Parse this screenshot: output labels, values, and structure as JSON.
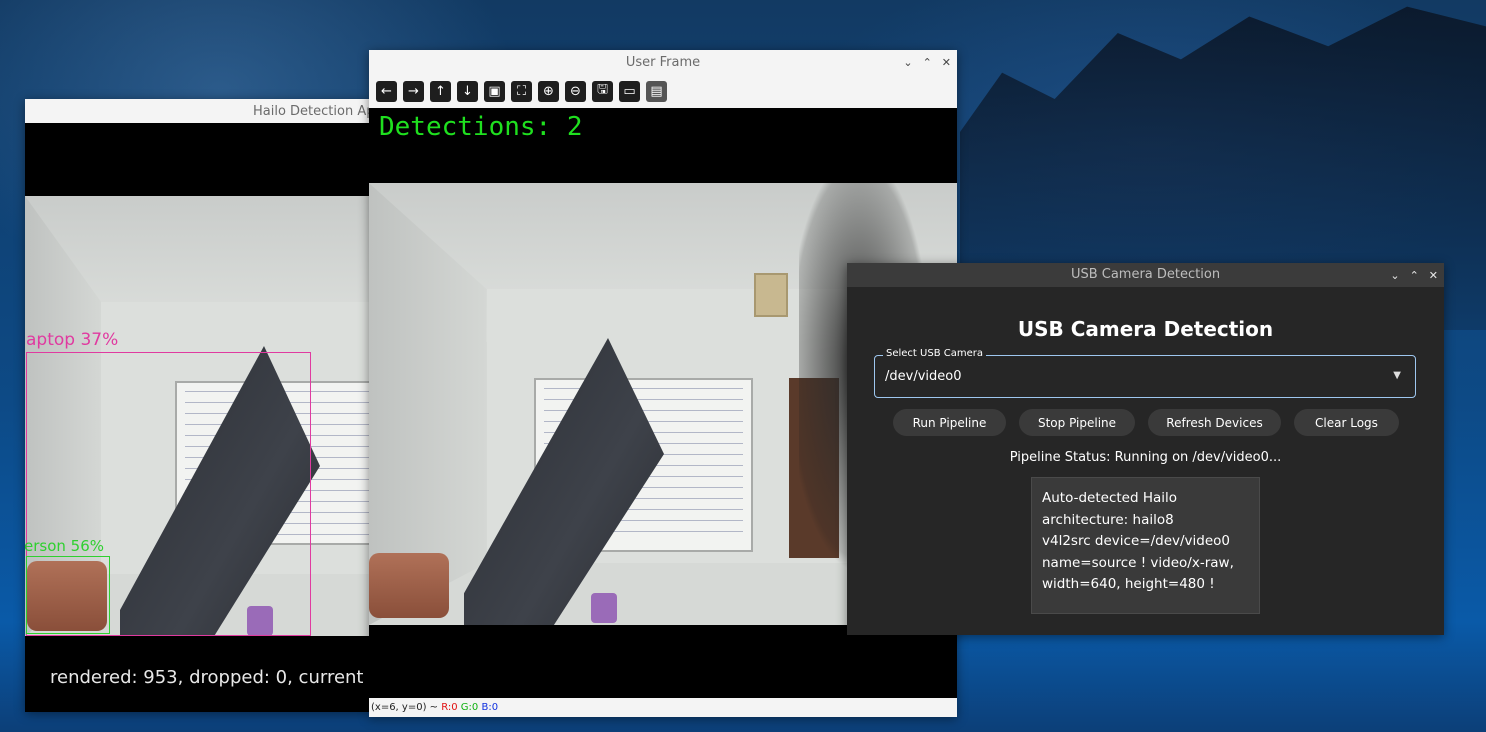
{
  "hailo_window": {
    "title": "Hailo Detection Ap",
    "detections": [
      {
        "label": "aptop 37%",
        "color": "#e03aa0"
      },
      {
        "label": "erson 56%",
        "color": "#2fd02f"
      }
    ],
    "stats_text": "rendered: 953, dropped: 0, current"
  },
  "user_frame": {
    "title": "User Frame",
    "controls": [
      "chevron-down-icon",
      "chevron-up-icon",
      "close-icon"
    ],
    "toolbar": [
      {
        "name": "pan-left",
        "icon": "←"
      },
      {
        "name": "pan-right",
        "icon": "→"
      },
      {
        "name": "pan-up",
        "icon": "↑"
      },
      {
        "name": "pan-down",
        "icon": "↓"
      },
      {
        "name": "zoom-image",
        "icon": "▣"
      },
      {
        "name": "zoom-fit",
        "icon": "⛶"
      },
      {
        "name": "zoom-in",
        "icon": "⊕"
      },
      {
        "name": "zoom-out",
        "icon": "⊖"
      },
      {
        "name": "save",
        "icon": "🖫"
      },
      {
        "name": "copy",
        "icon": "▭"
      },
      {
        "name": "properties",
        "icon": "▤"
      }
    ],
    "detections_text": "Detections: 2",
    "status": {
      "coords": "(x=6, y=0) ~",
      "r": "R:0",
      "g": "G:0",
      "b": "B:0"
    }
  },
  "usb_window": {
    "title": "USB Camera Detection",
    "heading": "USB Camera Detection",
    "select_label": "Select USB Camera",
    "select_value": "/dev/video0",
    "buttons": {
      "run": "Run Pipeline",
      "stop": "Stop Pipeline",
      "refresh": "Refresh Devices",
      "clear": "Clear Logs"
    },
    "status": "Pipeline Status: Running on /dev/video0...",
    "log_lines": [
      "Auto-detected Hailo",
      "architecture: hailo8",
      "v4l2src device=/dev/video0",
      "name=source ! video/x-raw,",
      "width=640, height=480 !"
    ]
  }
}
